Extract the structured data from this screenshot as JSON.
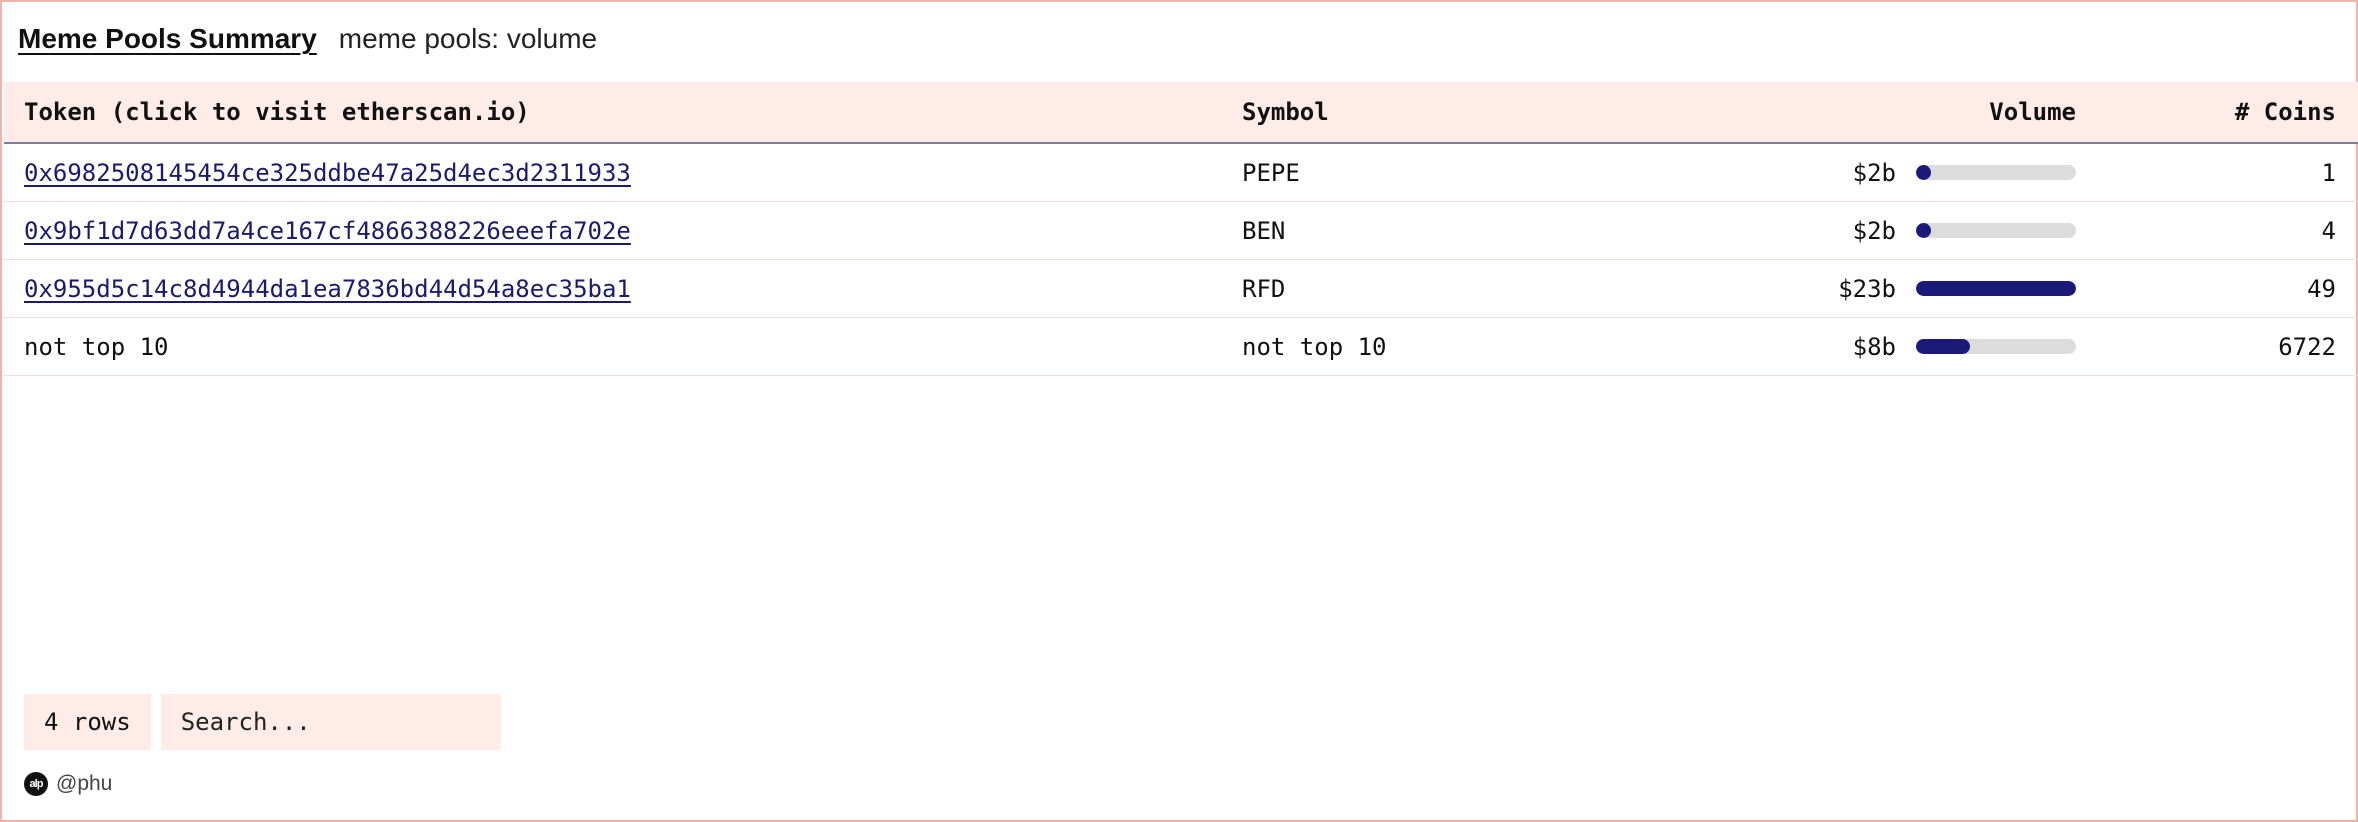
{
  "header": {
    "title": "Meme Pools Summary",
    "subtitle": "meme pools: volume"
  },
  "table": {
    "columns": {
      "token": "Token (click to visit etherscan.io)",
      "symbol": "Symbol",
      "volume": "Volume",
      "coins": "# Coins"
    },
    "rows": [
      {
        "token": "0x6982508145454ce325ddbe47a25d4ec3d2311933",
        "symbol": "PEPE",
        "volume": "$2b",
        "volume_fraction": 0.09,
        "coins": "1"
      },
      {
        "token": "0x9bf1d7d63dd7a4ce167cf4866388226eeefa702e",
        "symbol": "BEN",
        "volume": "$2b",
        "volume_fraction": 0.09,
        "coins": "4"
      },
      {
        "token": "0x955d5c14c8d4944da1ea7836bd44d54a8ec35ba1",
        "symbol": "RFD",
        "volume": "$23b",
        "volume_fraction": 1.0,
        "coins": "49"
      },
      {
        "token": "not top 10",
        "symbol": "not top 10",
        "volume": "$8b",
        "volume_fraction": 0.34,
        "coins": "6722"
      }
    ]
  },
  "footer": {
    "rows_count": "4 rows",
    "search_placeholder": "Search...",
    "author_avatar": "alp",
    "author": "@phu"
  },
  "colors": {
    "header_bg": "#ffebe7",
    "bar_fill": "#1c1a78",
    "bar_track": "#dcdcdc",
    "link": "#1a1a6e",
    "frame_border": "#f0b3aa"
  }
}
